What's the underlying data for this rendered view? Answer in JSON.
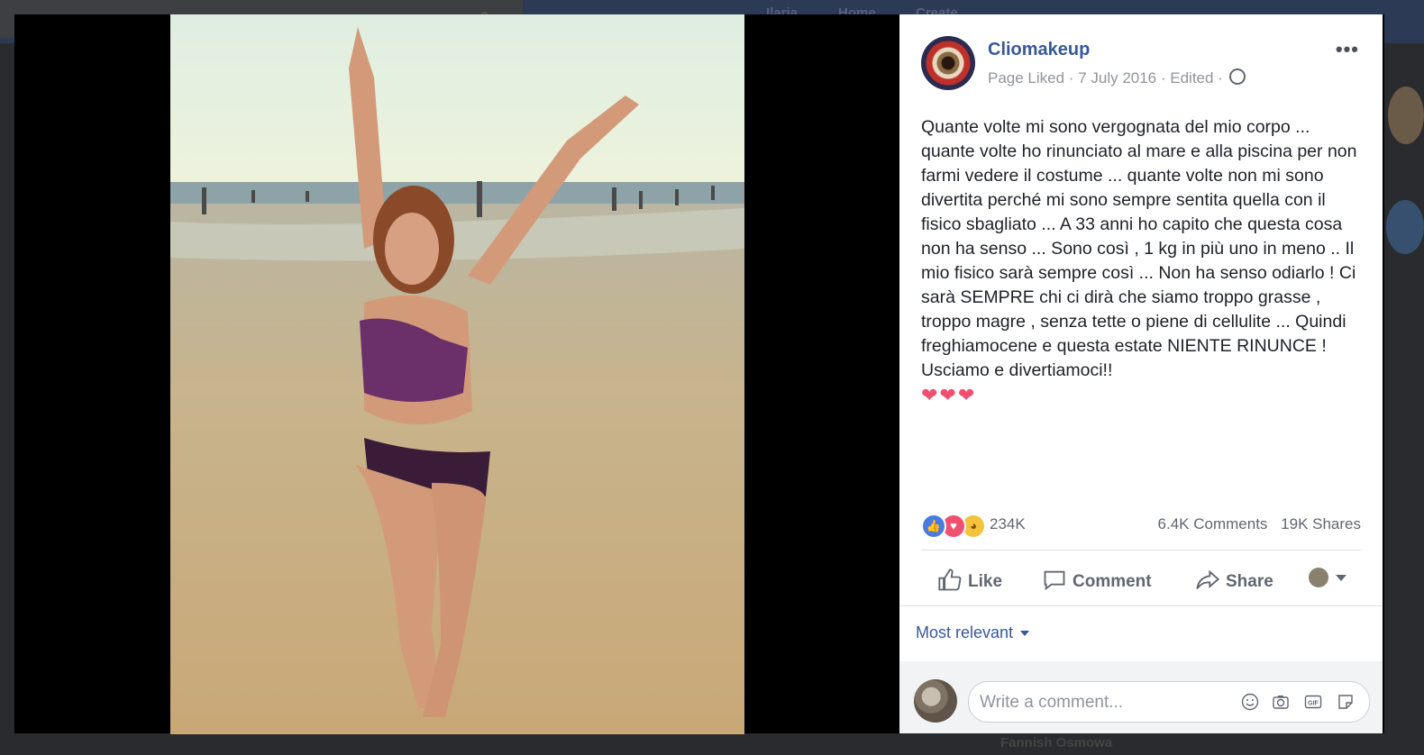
{
  "background": {
    "nav": [
      "Ilaria",
      "Home",
      "Create"
    ],
    "footer_name": "Fannish Osmowa"
  },
  "post": {
    "page_name": "Cliomakeup",
    "status": "Page Liked",
    "date": "7 July 2016",
    "edited": "Edited",
    "text": "Quante volte mi sono vergognata del mio corpo ... quante volte ho rinunciato al mare e alla piscina per non farmi vedere il costume ... quante volte non mi sono divertita perché mi sono sempre sentita quella con il fisico sbagliato ... A 33 anni ho capito che questa cosa non ha senso ... Sono così , 1 kg in più uno in meno .. Il mio fisico sarà sempre così ... Non ha senso odiarlo ! Ci sarà SEMPRE chi ci dirà che siamo troppo grasse , troppo magre , senza tette o piene di cellulite ... Quindi freghiamocene e questa estate NIENTE RINUNCE ! Usciamo e divertiamoci!!",
    "emoji": "❤❤❤"
  },
  "engagement": {
    "reaction_count": "234K",
    "comments": "6.4K Comments",
    "shares": "19K Shares"
  },
  "actions": {
    "like": "Like",
    "comment": "Comment",
    "share": "Share"
  },
  "comments": {
    "sort_label": "Most relevant",
    "input_placeholder": "Write a comment..."
  },
  "icons": [
    "globe-icon",
    "more-icon",
    "like-reaction-icon",
    "love-reaction-icon",
    "wow-reaction-icon",
    "thumbs-up-icon",
    "comment-bubble-icon",
    "share-arrow-icon",
    "emoji-icon",
    "camera-icon",
    "gif-icon",
    "sticker-icon"
  ],
  "colors": {
    "link": "#385898",
    "text": "#1d2129",
    "muted": "#90949c",
    "love": "#f0506e",
    "like": "#4a7be0"
  }
}
